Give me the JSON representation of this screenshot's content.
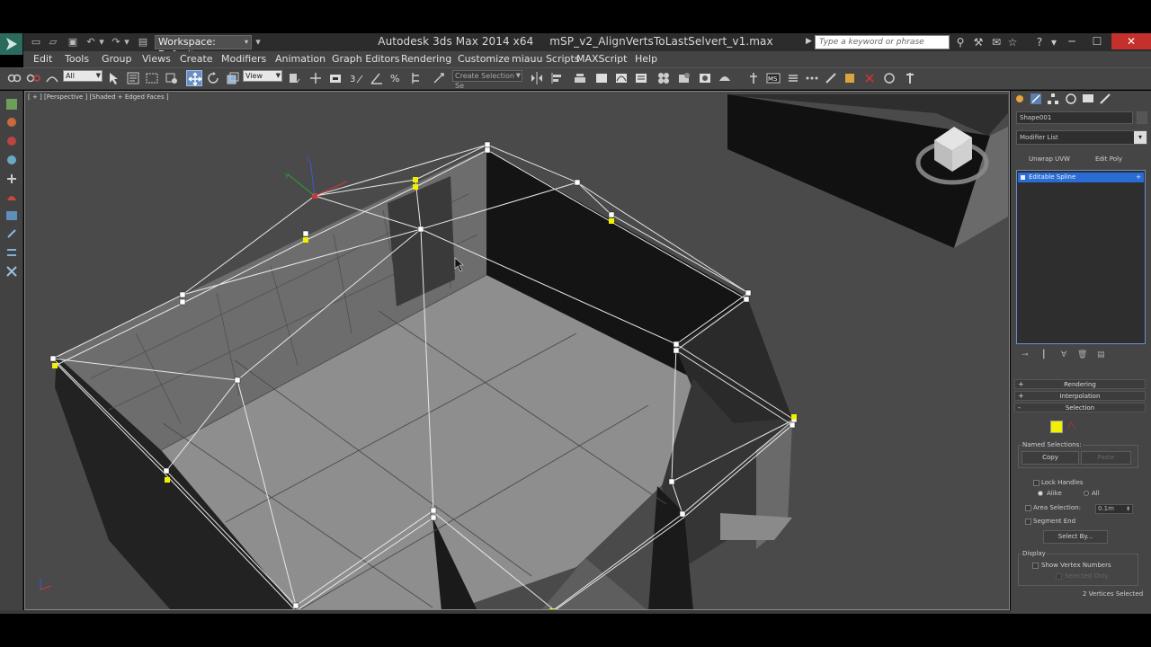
{
  "window": {
    "app_title": "Autodesk 3ds Max  2014 x64",
    "file_name": "mSP_v2_AlignVertsToLastSelvert_v1.max",
    "workspace": "Workspace: Default",
    "search_placeholder": "Type a keyword or phrase"
  },
  "menu": {
    "items": [
      "Edit",
      "Tools",
      "Group",
      "Views",
      "Create",
      "Modifiers",
      "Animation",
      "Graph Editors",
      "Rendering",
      "Customize",
      "miauu Scripts",
      "MAXScript",
      "Help"
    ]
  },
  "toolbar": {
    "selection_filter": "All",
    "reference_coord": "View",
    "named_selection_set": "Create Selection Se"
  },
  "viewport": {
    "label": "[ + ] [Perspective ] [Shaded + Edged Faces ]"
  },
  "command_panel": {
    "object_name": "Shape001",
    "modifier_list": "Modifier List",
    "buttons": [
      "Unwrap UVW",
      "Edit Poly"
    ],
    "stack_item": "Editable Spline",
    "rollouts": [
      {
        "sign": "+",
        "label": "Rendering"
      },
      {
        "sign": "+",
        "label": "Interpolation"
      },
      {
        "sign": "-",
        "label": "Selection"
      }
    ],
    "selection": {
      "named_selections_label": "Named Selections:",
      "copy_label": "Copy",
      "paste_label": "Paste",
      "lock_handles_label": "Lock Handles",
      "alike_label": "Alike",
      "all_label": "All",
      "area_selection_label": "Area Selection:",
      "area_value": "0.1m",
      "segment_end_label": "Segment End",
      "select_by_label": "Select By...",
      "display_label": "Display",
      "show_vertex_numbers_label": "Show Vertex Numbers",
      "selected_only_label": "Selected Only",
      "status": "2 Vertices Selected"
    }
  },
  "colors": {
    "selected_vertex": "#f0f000",
    "stack_highlight": "#2b6cd4",
    "close_button": "#c4302b"
  }
}
